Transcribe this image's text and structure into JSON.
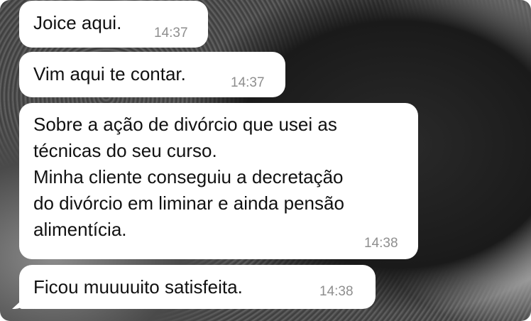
{
  "chat": {
    "messages": [
      {
        "text": "Joice aqui.",
        "time": "14:37"
      },
      {
        "text": "Vim aqui te contar.",
        "time": "14:37"
      },
      {
        "lines": [
          "Sobre a ação de divórcio que usei as",
          "técnicas do seu curso.",
          "Minha cliente conseguiu a decretação",
          "do divórcio em liminar e ainda pensão",
          "alimentícia."
        ],
        "time": "14:38"
      },
      {
        "text": "Ficou muuuuito satisfeita.",
        "time": "14:38"
      }
    ]
  },
  "colors": {
    "bubble": "#ffffff",
    "text": "#111111",
    "timestamp": "#8e8e8e"
  },
  "background": "grayscale photo wallpaper"
}
